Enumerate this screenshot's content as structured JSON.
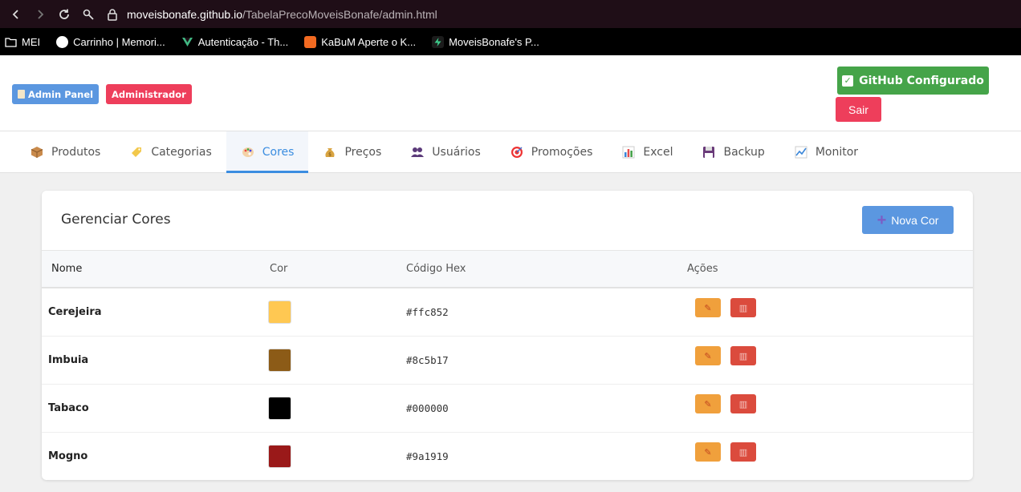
{
  "browser": {
    "url_host": "moveisbonafe.github.io",
    "url_path": "/TabelaPrecoMoveisBonafe/admin.html",
    "bookmarks": [
      {
        "label": "MEI",
        "icon": "folder-icon"
      },
      {
        "label": "Carrinho | Memori...",
        "icon": "site-icon"
      },
      {
        "label": "Autenticação - Th...",
        "icon": "vuetify-icon"
      },
      {
        "label": "KaBuM Aperte o K...",
        "icon": "kabum-icon"
      },
      {
        "label": "MoveisBonafe's P...",
        "icon": "supabase-icon"
      }
    ]
  },
  "header": {
    "panel_badge": "Admin Panel",
    "role_badge": "Administrador",
    "github_button": "GitHub Configurado",
    "logout_button": "Sair"
  },
  "tabs": [
    {
      "label": "Produtos",
      "icon": "package-icon"
    },
    {
      "label": "Categorias",
      "icon": "tag-icon"
    },
    {
      "label": "Cores",
      "icon": "palette-icon"
    },
    {
      "label": "Preços",
      "icon": "money-bag-icon"
    },
    {
      "label": "Usuários",
      "icon": "users-icon"
    },
    {
      "label": "Promoções",
      "icon": "target-icon"
    },
    {
      "label": "Excel",
      "icon": "chart-icon"
    },
    {
      "label": "Backup",
      "icon": "floppy-icon"
    },
    {
      "label": "Monitor",
      "icon": "line-chart-icon"
    }
  ],
  "active_tab": "Cores",
  "card": {
    "title": "Gerenciar Cores",
    "new_button": "Nova Cor",
    "columns": [
      "Nome",
      "Cor",
      "Código Hex",
      "Ações"
    ],
    "rows": [
      {
        "name": "Cerejeira",
        "hex": "#ffc852"
      },
      {
        "name": "Imbuia",
        "hex": "#8c5b17"
      },
      {
        "name": "Tabaco",
        "hex": "#000000"
      },
      {
        "name": "Mogno",
        "hex": "#9a1919"
      }
    ]
  },
  "colors": {
    "accent": "#3b8de0",
    "success": "#45a449",
    "danger": "#ee3e5b",
    "edit": "#f0a03c",
    "delete": "#db4b3d"
  }
}
